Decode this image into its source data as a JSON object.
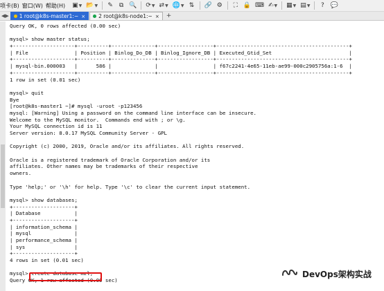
{
  "menubar": {
    "items": [
      "项卡(B)",
      "窗口(W)",
      "帮助(H)"
    ],
    "toolbar": [
      {
        "icon": "new-session-icon",
        "glyph": "▣"
      },
      {
        "icon": "open-folder-icon",
        "glyph": "📂"
      },
      {
        "icon": "edit-icon",
        "glyph": "✎"
      },
      {
        "icon": "copy-icon",
        "glyph": "⧉"
      },
      {
        "icon": "search-icon",
        "glyph": "🔍"
      },
      {
        "icon": "refresh-icon",
        "glyph": "⟳"
      },
      {
        "icon": "transfer-icon",
        "glyph": "⇄"
      },
      {
        "icon": "globe-icon",
        "glyph": "🌐"
      },
      {
        "icon": "sftp-icon",
        "glyph": "⇅"
      },
      {
        "icon": "link-icon",
        "glyph": "🔗"
      },
      {
        "icon": "script-icon",
        "glyph": "⚙"
      },
      {
        "icon": "fullscreen-icon",
        "glyph": "⛶"
      },
      {
        "icon": "lock-icon",
        "glyph": "🔒"
      },
      {
        "icon": "keyboard-icon",
        "glyph": "⌨"
      },
      {
        "icon": "compose-icon",
        "glyph": "✍"
      },
      {
        "icon": "layout-icon",
        "glyph": "▦"
      },
      {
        "icon": "options-icon",
        "glyph": "▤"
      },
      {
        "icon": "help-icon",
        "glyph": "?"
      },
      {
        "icon": "chat-icon",
        "glyph": "💬"
      }
    ]
  },
  "tabs": [
    {
      "label": "1 root@k8s-master1:~",
      "close": "×",
      "active": true,
      "dot_color": "#f2c200"
    },
    {
      "label": "2 root@k8s-node1:~",
      "close": "×",
      "active": false,
      "dot_color": "#16a34a"
    }
  ],
  "tab_add": "+",
  "terminal": {
    "lines": [
      "Query OK, 0 rows affected (0.00 sec)",
      "",
      "mysql> show master status;",
      "+--------------------+----------+--------------+------------------+-------------------------------------------+",
      "| File               | Position | Binlog_Do_DB | Binlog_Ignore_DB | Executed_Gtid_Set                         |",
      "+--------------------+----------+--------------+------------------+-------------------------------------------+",
      "| mysql-bin.000003   |      586 |              |                  | f67c2241-4e65-11eb-ae99-000c2905756a:1-6  |",
      "+--------------------+----------+--------------+------------------+-------------------------------------------+",
      "1 row in set (0.01 sec)",
      "",
      "mysql> quit",
      "Bye",
      "[root@k8s-master1 ~]# mysql -uroot -p123456",
      "mysql: [Warning] Using a password on the command line interface can be insecure.",
      "Welcome to the MySQL monitor.  Commands end with ; or \\g.",
      "Your MySQL connection id is 11",
      "Server version: 8.0.17 MySQL Community Server - GPL",
      "",
      "Copyright (c) 2000, 2019, Oracle and/or its affiliates. All rights reserved.",
      "",
      "Oracle is a registered trademark of Oracle Corporation and/or its",
      "affiliates. Other names may be trademarks of their respective",
      "owners.",
      "",
      "Type 'help;' or '\\h' for help. Type '\\c' to clear the current input statement.",
      "",
      "mysql> show databases;",
      "+--------------------+",
      "| Database           |",
      "+--------------------+",
      "| information_schema |",
      "| mysql              |",
      "| performance_schema |",
      "| sys                |",
      "+--------------------+",
      "4 rows in set (0.01 sec)",
      "",
      "mysql> create database mzl;",
      "Query OK, 1 row affected (0.00 sec)"
    ]
  },
  "watermark": {
    "text": "DevOps架构实战",
    "icon": "wechat-channel-logo-icon"
  },
  "colors": {
    "active_tab": "#2d6ad4",
    "highlight_box": "#e01010",
    "terminal_bg": "#ffffff",
    "terminal_text": "#111111"
  }
}
